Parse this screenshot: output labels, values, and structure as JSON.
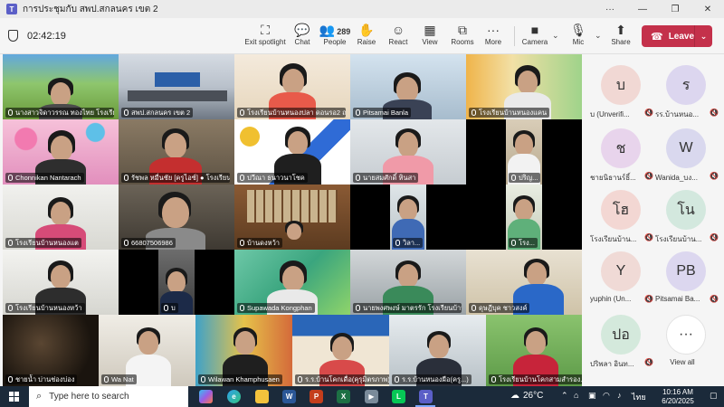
{
  "window": {
    "title": "การประชุมกับ สพป.สกลนคร เขต 2"
  },
  "toolbar": {
    "timer": "02:42:19",
    "exit_spotlight": "Exit spotlight",
    "chat": "Chat",
    "people": "People",
    "people_count": "289",
    "raise": "Raise",
    "react": "React",
    "view": "View",
    "rooms": "Rooms",
    "more": "More",
    "camera": "Camera",
    "mic": "Mic",
    "share": "Share",
    "leave": "Leave"
  },
  "tiles": [
    "นางสาวจิดาวรรณ ทองไทย โรงเรียนบ้าน...",
    "สพป.สกลนคร เขต 2",
    "โรงเรียนบ้านหนองปลา ดอนรอ2 ณ.แล้วๆ...",
    "Pitsamai Banla",
    "โรงเรียนบ้านหนองแคน",
    "Chonnikan Nantarach",
    "รัชพล หมื่นชัย [ครูไอซ์] ● โรงเรียน...",
    "ปวีณา ธนาวนาโชค",
    "นายสมศักดิ์ หินสา",
    "ปริญ...",
    "โรงเรียนบ้านหนองแต",
    "66807506986",
    "บ้านดงหว้า",
    "วิลา...",
    "โรง...",
    "โรงเรียนบ้านหนองหว้า",
    "บ",
    "Supawada Kongphan",
    "นายพงศพงษ์ มาตรรัก โรงเรียนบ้าน...",
    "ดุษฎีบุค ชาวสงค์",
    "ชายน้ำ บ่านช่องบ่อง",
    "Wa Nat",
    "Wilawan Khamphusaen",
    "ร.ร.บ้านโคกเดื่อ(คุรุมิตรภาพ)",
    "ร.ร.บ้านหนองผือ(ครู...)",
    "โรงเรียนบ้านโคกสามสำรอง..."
  ],
  "participants": [
    {
      "initials": "บ",
      "name": "บ (Unverifi...",
      "color": "#f1d8d4"
    },
    {
      "initials": "ร",
      "name": "รร.บ้านหนอ...",
      "color": "#dcd6ef"
    },
    {
      "initials": "ช",
      "name": "ชายนิธานร์ธิ์...",
      "color": "#e8d4ec"
    },
    {
      "initials": "W",
      "name": "Wanida_บง...",
      "color": "#d9d8ee"
    },
    {
      "initials": "โฮ",
      "name": "โรงเรียนบ้าน...",
      "color": "#f3d7d3"
    },
    {
      "initials": "โน",
      "name": "โรงเรียนบ้าน...",
      "color": "#d3e8de"
    },
    {
      "initials": "Y",
      "name": "yuphin (Un...",
      "color": "#f0dad6"
    },
    {
      "initials": "PB",
      "name": "Pitsamai Ba...",
      "color": "#dcd7ef"
    },
    {
      "initials": "ปอ",
      "name": "ปริพลา อินท...",
      "color": "#d4e9dc"
    },
    {
      "initials": "···",
      "name": "View all",
      "color": "#ffffff"
    }
  ],
  "taskbar": {
    "search_placeholder": "Type here to search",
    "temperature": "26°C",
    "language": "ไทย",
    "time": "10:16 AM",
    "date": "6/20/2025"
  }
}
